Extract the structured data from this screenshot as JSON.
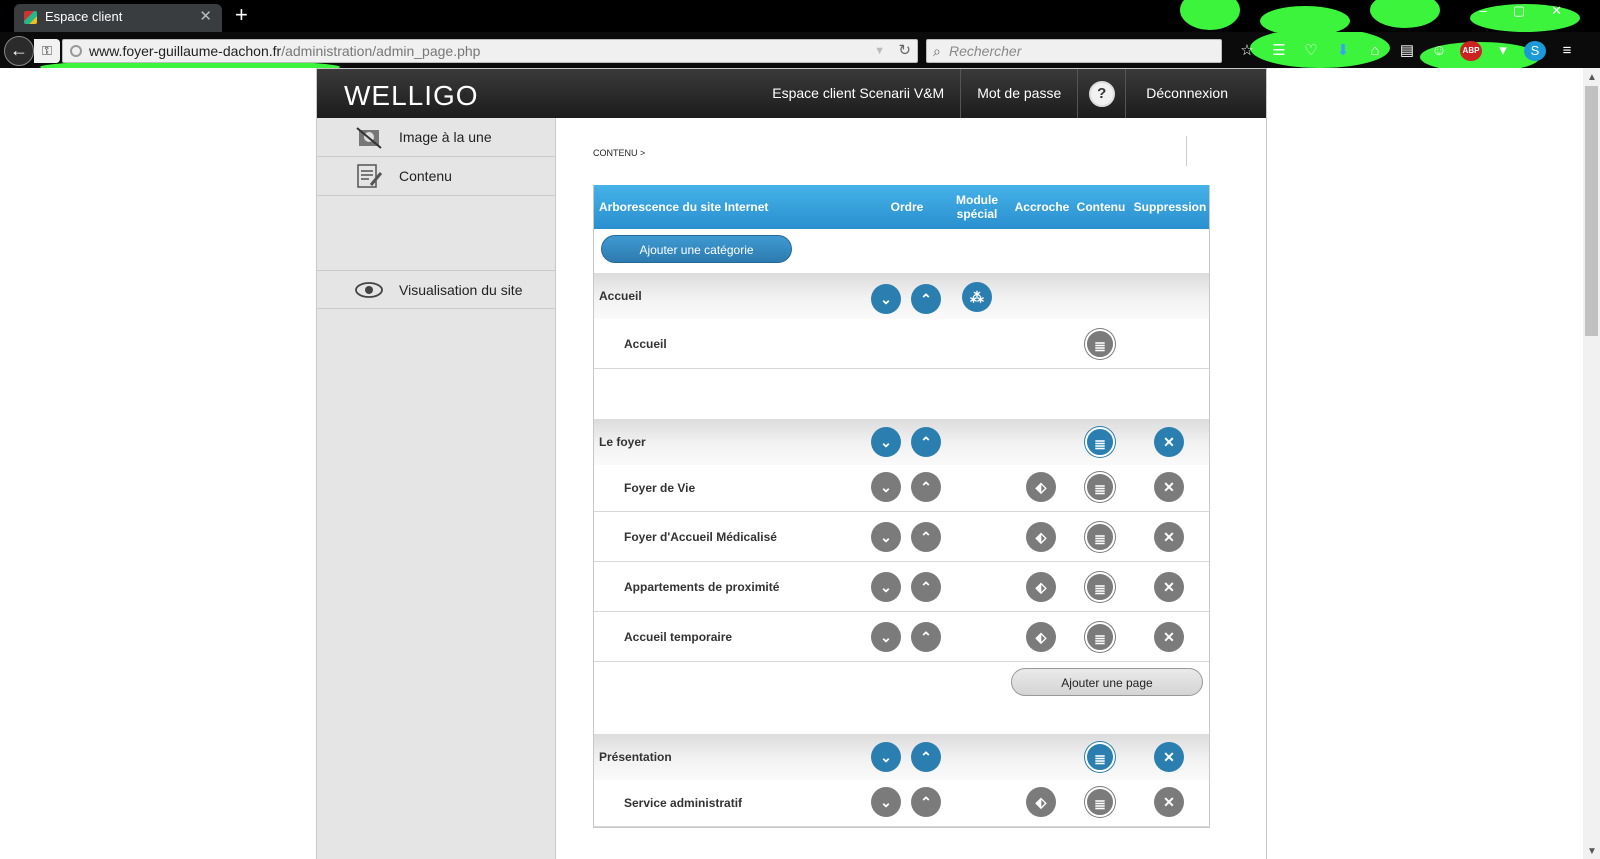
{
  "browser": {
    "tab_title": "Espace client",
    "new_tab": "+",
    "url_host": "www.foyer-guillaume-dachon.fr",
    "url_path": "/administration/admin_page.php",
    "search_placeholder": "Rechercher"
  },
  "header": {
    "logo": "WELLIGO",
    "nav_space": "Espace client Scenarii V&M",
    "nav_password": "Mot de passe",
    "help": "?",
    "logout": "Déconnexion"
  },
  "sidebar": {
    "image": "Image à la une",
    "content": "Contenu",
    "visualize": "Visualisation du site"
  },
  "breadcrumb": "CONTENU >",
  "table": {
    "col_tree": "Arborescence du site Internet",
    "col_order": "Ordre",
    "col_module": "Module spécial",
    "col_hook": "Accroche",
    "col_content": "Contenu",
    "col_delete": "Suppression",
    "add_category": "Ajouter une catégorie",
    "add_page": "Ajouter une page"
  },
  "categories": [
    {
      "name": "Accueil",
      "pages": [
        "Accueil"
      ]
    },
    {
      "name": "Le foyer",
      "pages": [
        "Foyer de Vie",
        "Foyer d'Accueil Médicalisé",
        "Appartements de proximité",
        "Accueil temporaire"
      ]
    },
    {
      "name": "Présentation",
      "pages": [
        "Service administratif"
      ]
    }
  ],
  "colors": {
    "accent_blue": "#2a7fb0",
    "header_blue": "#3aa5de",
    "icon_gray": "#7b7b7b"
  }
}
